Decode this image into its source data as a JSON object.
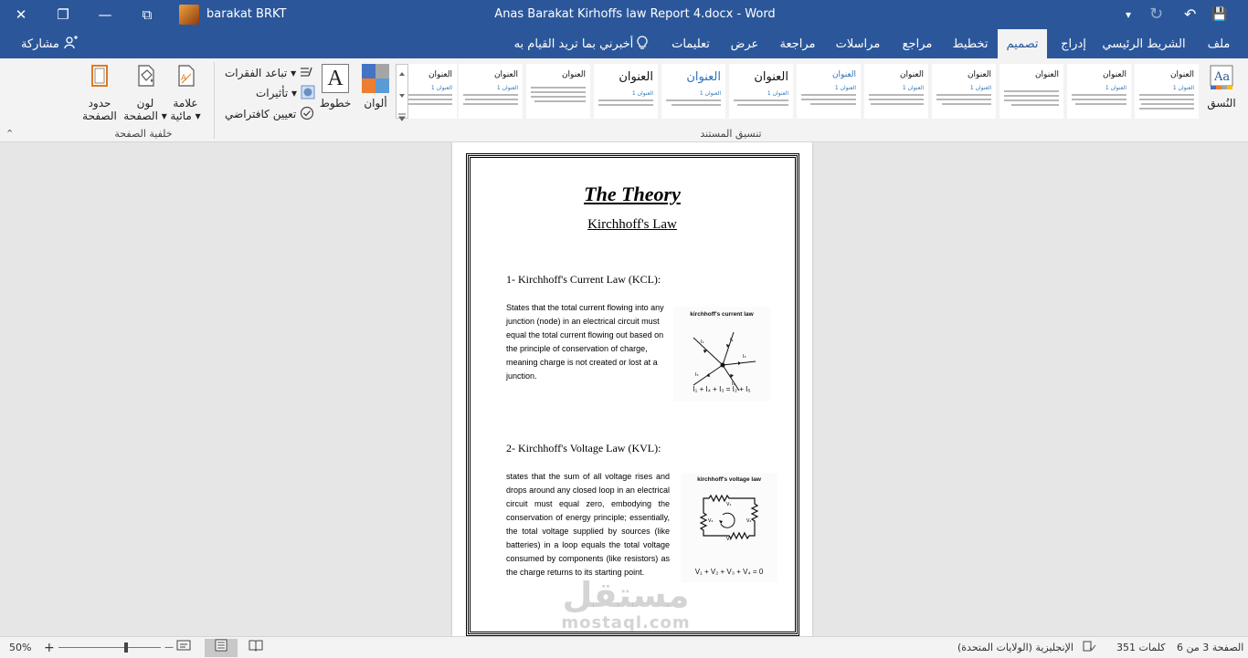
{
  "titlebar": {
    "user_name": "barakat BRKT",
    "document_title": "Anas Barakat Kirhoffs law Report 4.docx  -  Word",
    "close_glyph": "✕",
    "restore_glyph": "❐",
    "ribbon_display_glyph": "⧉",
    "minimize_glyph": "—",
    "customize_glyph": "▾",
    "redo_glyph": "↻",
    "undo_glyph": "↶",
    "save_glyph": "💾"
  },
  "tabs": {
    "share": "مشاركة",
    "tell_me": "أخبرني بما تريد القيام به",
    "help": "تعليمات",
    "view": "عرض",
    "review": "مراجعة",
    "mailings": "مراسلات",
    "references": "مراجع",
    "layout": "تخطيط",
    "design": "تصميم",
    "insert": "إدراج",
    "home": "الشريط الرئيسي",
    "file": "ملف"
  },
  "ribbon": {
    "page_background": {
      "label": "خلفية الصفحة",
      "page_borders": [
        "حدود",
        "الصفحة"
      ],
      "page_color": [
        "لون",
        "الصفحة ▾"
      ],
      "watermark": [
        "علامة",
        "مائية ▾"
      ]
    },
    "document_formatting": {
      "label": "تنسيق المستند",
      "paragraph_spacing": "تباعد الفقرات ▾",
      "effects": "تأثيرات ▾",
      "set_as_default": "تعيين كافتراضي",
      "fonts": "خطوط",
      "fonts_glyph": "A",
      "colors": "ألوان",
      "themes": "النُسق",
      "style_title": "العنوان",
      "style_heading": "العنوان 1"
    },
    "collapse_glyph": "⌃"
  },
  "colors": {
    "word_blue": "#2b579a",
    "heading_blue": "#2e74b5"
  },
  "document": {
    "title": "The Theory",
    "subtitle": "Kirchhoff's Law",
    "kcl_heading": "1- Kirchhoff's Current Law (KCL):",
    "kcl_text": "States that the total current flowing into any junction (node) in an electrical circuit must equal the total current flowing out based on the principle of conservation of charge, meaning charge is not created or lost at a junction.",
    "kcl_figure_caption": "kirchhoff's current law",
    "kcl_figure_equation": "I₁ + I₄ + I₃ = I₂ + I₅",
    "kvl_heading": "2- Kirchhoff's Voltage Law (KVL):",
    "kvl_text": "states that the sum of all voltage rises and drops around any closed loop in an electrical circuit must equal zero, embodying the conservation of energy principle; essentially, the total voltage supplied by sources (like batteries) in a loop equals the total voltage consumed by components (like resistors) as the charge returns to its starting point.",
    "kvl_figure_caption": "kirchhoff's voltage law",
    "kvl_figure_equation": "V₁ + V₂ + V₃ + V₄ = 0",
    "watermark_text": "مستقل",
    "watermark_url": "mostaql.com"
  },
  "statusbar": {
    "page_info": "الصفحة 3 من 6",
    "word_count": "351 كلمات",
    "language": "الإنجليزية (الولايات المتحدة)",
    "zoom": "50%",
    "zoom_in": "+",
    "zoom_out": "—"
  }
}
